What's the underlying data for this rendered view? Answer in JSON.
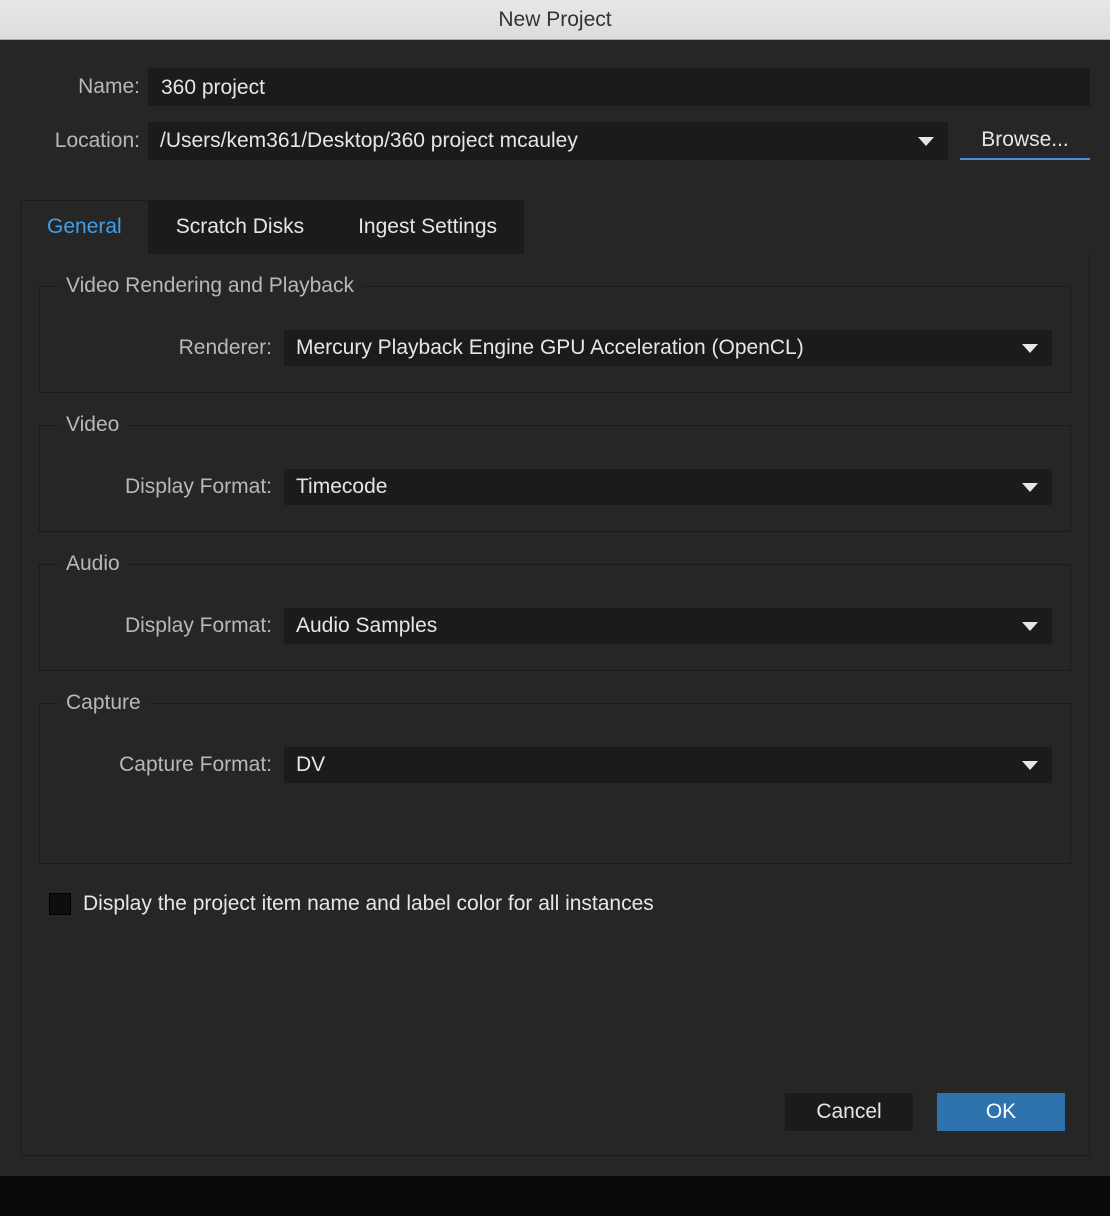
{
  "title": "New Project",
  "name": {
    "label": "Name:",
    "value": "360 project"
  },
  "location": {
    "label": "Location:",
    "value": "/Users/kem361/Desktop/360 project mcauley",
    "browse": "Browse..."
  },
  "tabs": {
    "general": "General",
    "scratch": "Scratch Disks",
    "ingest": "Ingest Settings"
  },
  "groups": {
    "rendering": {
      "legend": "Video Rendering and Playback",
      "label": "Renderer:",
      "value": "Mercury Playback Engine GPU Acceleration (OpenCL)"
    },
    "video": {
      "legend": "Video",
      "label": "Display Format:",
      "value": "Timecode"
    },
    "audio": {
      "legend": "Audio",
      "label": "Display Format:",
      "value": "Audio Samples"
    },
    "capture": {
      "legend": "Capture",
      "label": "Capture Format:",
      "value": "DV"
    }
  },
  "checkbox": {
    "label": "Display the project item name and label color for all instances"
  },
  "buttons": {
    "cancel": "Cancel",
    "ok": "OK"
  }
}
